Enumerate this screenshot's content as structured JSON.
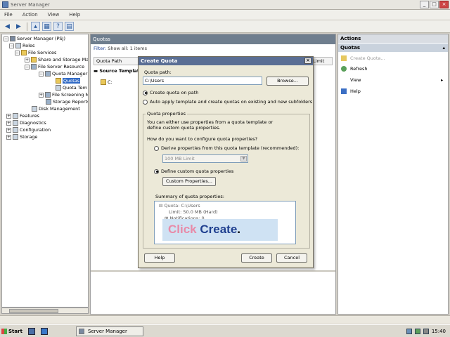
{
  "window": {
    "title": "Server Manager"
  },
  "menu": [
    "File",
    "Action",
    "View",
    "Help"
  ],
  "tree": {
    "root": "Server Manager (PSJ)",
    "items": [
      {
        "label": "Roles",
        "level": 1
      },
      {
        "label": "File Services",
        "level": 2
      },
      {
        "label": "Share and Storage Man",
        "level": 3
      },
      {
        "label": "File Server Resource",
        "level": 3
      },
      {
        "label": "Quota Manager",
        "level": 4
      },
      {
        "label": "Quotas",
        "level": 5,
        "selected": true
      },
      {
        "label": "Quota Tem",
        "level": 5
      },
      {
        "label": "File Screening Ma",
        "level": 4
      },
      {
        "label": "Storage Reports",
        "level": 4
      },
      {
        "label": "Disk Management",
        "level": 3
      },
      {
        "label": "Features",
        "level": 0
      },
      {
        "label": "Diagnostics",
        "level": 0
      },
      {
        "label": "Configuration",
        "level": 0
      },
      {
        "label": "Storage",
        "level": 0
      }
    ]
  },
  "center": {
    "header": "Quotas",
    "filter_label": "Filter:",
    "filter_value": "Show all: 1 items",
    "columns": [
      "Quota Path",
      "",
      "",
      "Limit"
    ],
    "group": "Source Template",
    "row": "C:"
  },
  "actions": {
    "header": "Actions",
    "section": "Quotas",
    "items": [
      "Create Quota...",
      "Refresh",
      "View",
      "Help"
    ]
  },
  "dialog": {
    "title": "Create Quota",
    "quota_path_label": "Quota path:",
    "quota_path_value": "C:\\Users",
    "browse": "Browse...",
    "opt_create": "Create quota on path",
    "opt_auto": "Auto apply template and create quotas on existing and new subfolders",
    "props_group": "Quota properties",
    "props_desc": "You can either use properties from a quota template or define custom quota properties.",
    "how_label": "How do you want to configure quota properties?",
    "derive": "Derive properties from this quota template (recommended):",
    "template_select": "100 MB Limit",
    "custom": "Define custom quota properties",
    "custom_btn": "Custom Properties...",
    "summary_label": "Summary of quota properties:",
    "summary_line1": "Quota: C:\\Users",
    "summary_line2": "Limit: 50.0 MB (Hard)",
    "summary_line3": "Notifications: 0",
    "callout_w1": "Click",
    "callout_w2": "Create",
    "callout_dot": ".",
    "help": "Help",
    "create": "Create",
    "cancel": "Cancel"
  },
  "taskbar": {
    "start": "Start",
    "task": "Server Manager",
    "clock": "15:40"
  }
}
